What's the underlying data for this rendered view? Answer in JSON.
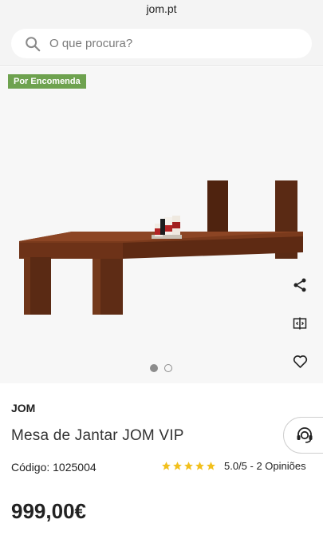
{
  "browser": {
    "url": "jom.pt"
  },
  "search": {
    "placeholder": "O que procura?"
  },
  "gallery": {
    "badge": "Por Encomenda",
    "slide_count": 2,
    "active_slide": 1
  },
  "product": {
    "brand": "JOM",
    "title": "Mesa de Jantar JOM VIP",
    "code": "Código: 1025004",
    "rating_stars": 5,
    "rating_text": "5.0/5 - 2 Opiniões",
    "price": "999,00€"
  },
  "icons": {
    "search": "search-icon",
    "share": "share-icon",
    "compare": "compare-icon",
    "wishlist": "heart-icon",
    "support": "support-agent-icon",
    "star": "star-icon"
  },
  "colors": {
    "badge": "#6ea24f",
    "star": "#f2c01c",
    "wood_dark": "#5a2a14",
    "wood": "#7a3a1c"
  }
}
